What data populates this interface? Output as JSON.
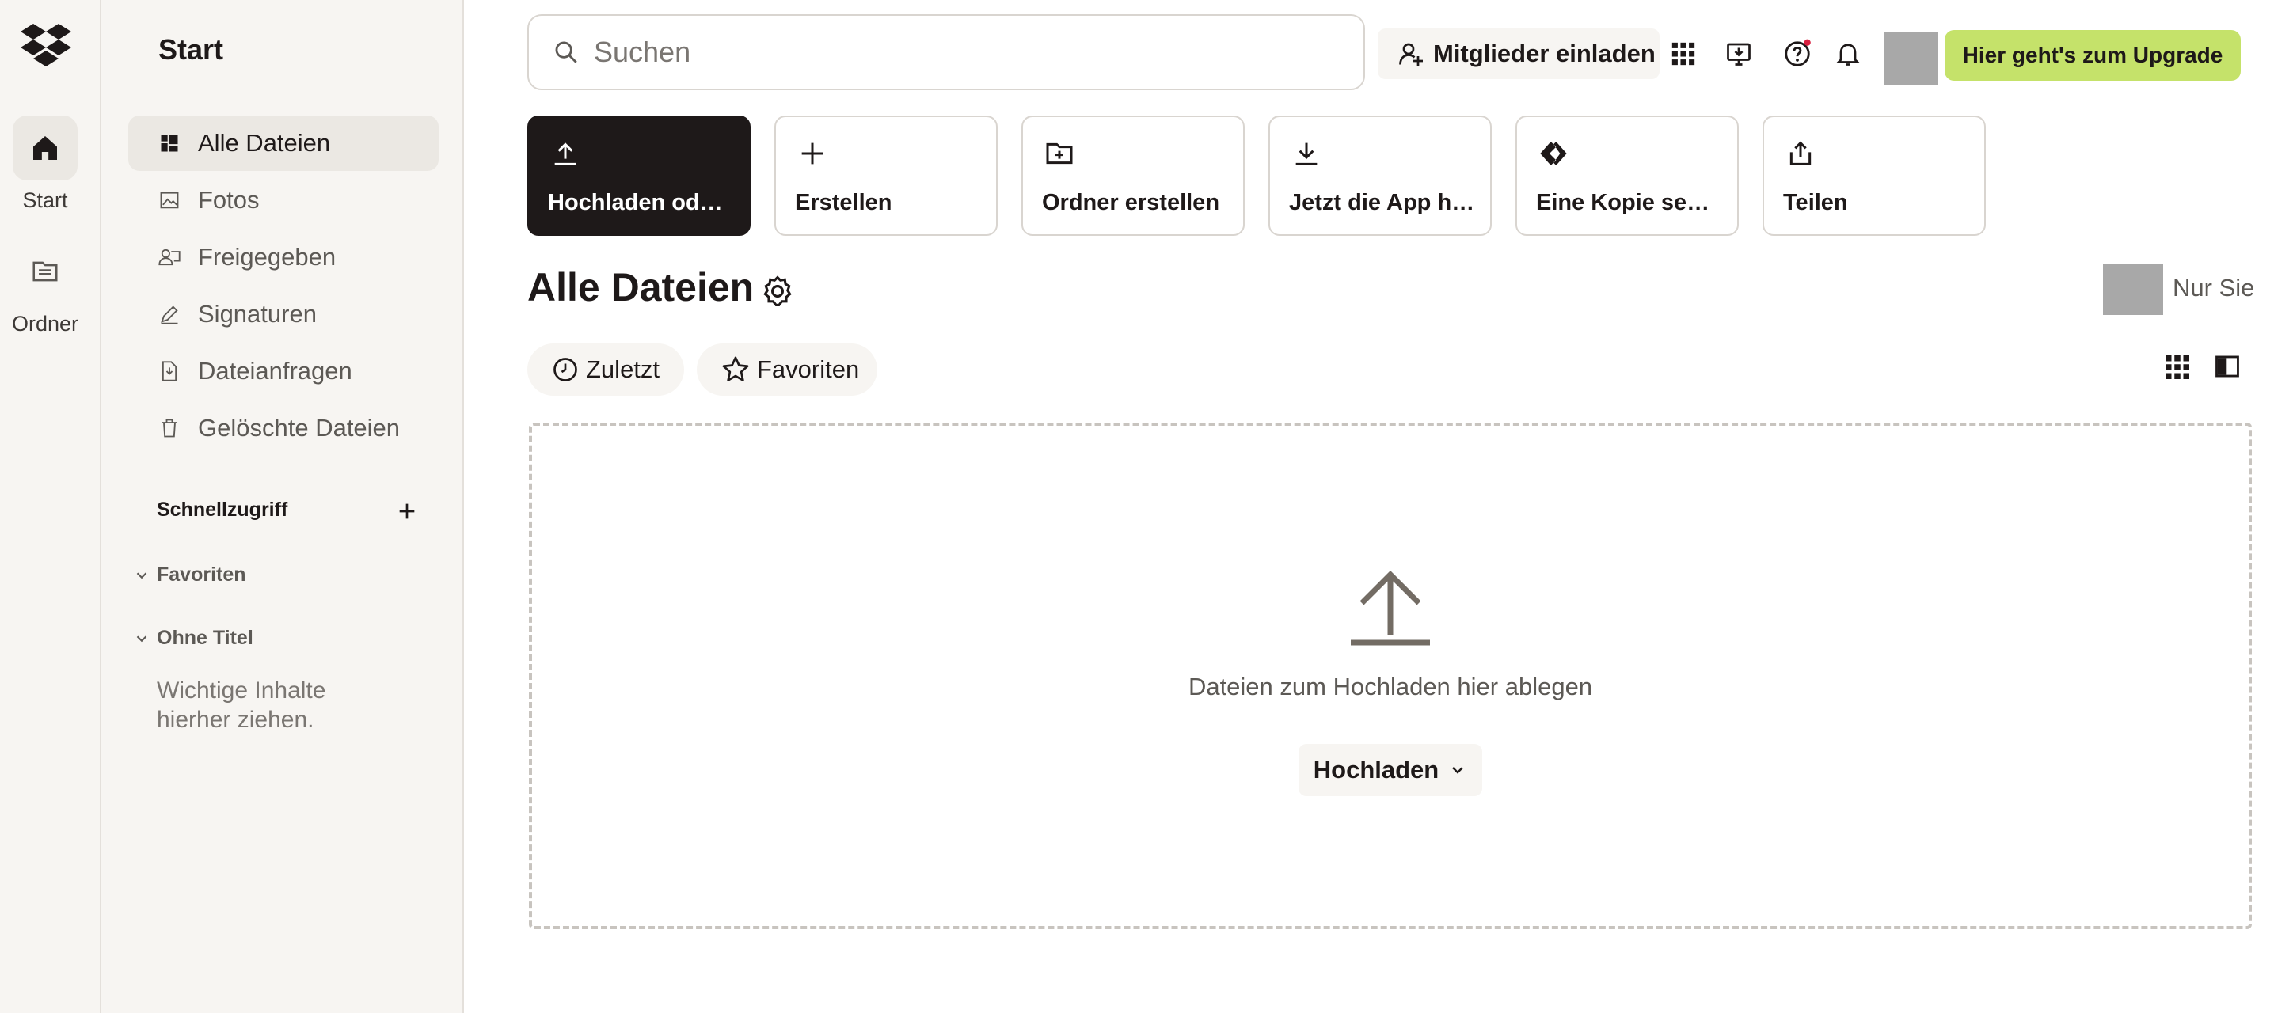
{
  "rail": {
    "items": [
      {
        "label": "Start"
      },
      {
        "label": "Ordner"
      }
    ]
  },
  "sidebar": {
    "title": "Start",
    "nav": [
      {
        "label": "Alle Dateien",
        "icon": "all-files-icon"
      },
      {
        "label": "Fotos",
        "icon": "photo-icon"
      },
      {
        "label": "Freigegeben",
        "icon": "shared-icon"
      },
      {
        "label": "Signaturen",
        "icon": "signature-icon"
      },
      {
        "label": "Dateianfragen",
        "icon": "file-request-icon"
      },
      {
        "label": "Gelöschte Dateien",
        "icon": "trash-icon"
      }
    ],
    "quick_access": "Schnellzugriff",
    "sections": [
      {
        "label": "Favoriten"
      },
      {
        "label": "Ohne Titel"
      }
    ],
    "hint": "Wichtige Inhalte hierher ziehen."
  },
  "topbar": {
    "search_placeholder": "Suchen",
    "invite_label": "Mitglieder einladen",
    "upgrade_label": "Hier geht's zum Upgrade"
  },
  "tiles": [
    {
      "label": "Hochladen oder Ablegen",
      "icon": "upload-icon"
    },
    {
      "label": "Erstellen",
      "icon": "plus-icon"
    },
    {
      "label": "Ordner erstellen",
      "icon": "new-folder-icon"
    },
    {
      "label": "Jetzt die App herunterladen",
      "icon": "download-icon"
    },
    {
      "label": "Eine Kopie senden",
      "icon": "transfer-icon"
    },
    {
      "label": "Teilen",
      "icon": "share-icon"
    }
  ],
  "main": {
    "title": "Alle Dateien",
    "owner_label": "Nur Sie",
    "filters": [
      {
        "label": "Zuletzt",
        "icon": "clock-icon"
      },
      {
        "label": "Favoriten",
        "icon": "star-icon"
      }
    ],
    "drop_text": "Dateien zum Hochladen hier ablegen",
    "upload_button": "Hochladen"
  },
  "colors": {
    "accent": "#c5e26a",
    "dark": "#1e1919",
    "sidebar_bg": "#f7f5f2"
  }
}
